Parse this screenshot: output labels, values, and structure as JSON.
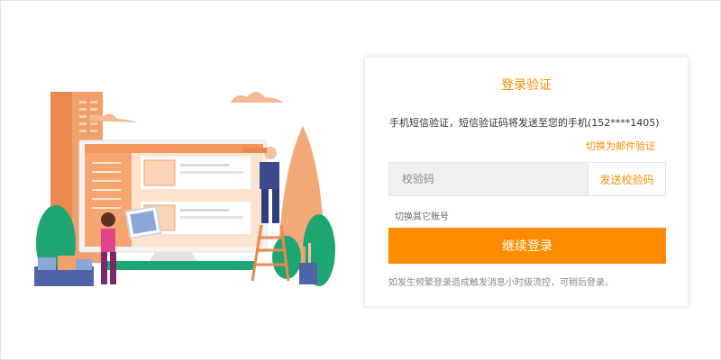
{
  "login": {
    "title": "登录验证",
    "description": "手机短信验证，短信验证码将发送至您的手机(152****1405)",
    "switch_email_label": "切换为邮件验证",
    "code_placeholder": "校验码",
    "send_code_label": "发送校验码",
    "switch_account_label": "切换其它账号",
    "continue_label": "继续登录",
    "note": "如发生频繁登录造成触发消息小时级流控，可稍后登录。"
  },
  "colors": {
    "accent": "#ff8c00",
    "input_bg": "#eef0f2"
  },
  "icons": {
    "illustration": "website-maintenance-illustration"
  }
}
